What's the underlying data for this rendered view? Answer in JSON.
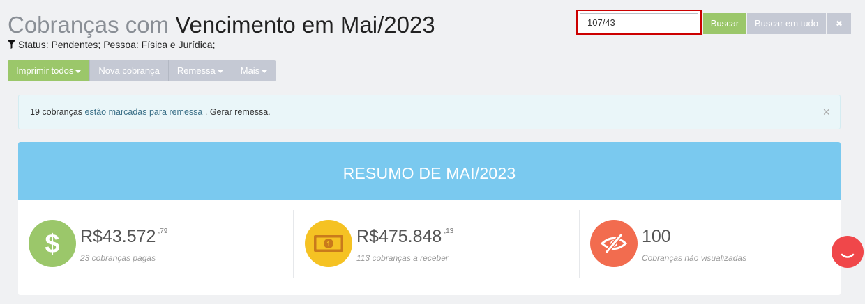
{
  "header": {
    "title_prefix": "Cobranças com",
    "title_main": "Vencimento em Mai/2023",
    "filter_text": "Status: Pendentes; Pessoa: Física e Jurídica;"
  },
  "search": {
    "value": "107/43",
    "buscar_label": "Buscar",
    "buscar_tudo_label": "Buscar em tudo",
    "clear_label": "✖"
  },
  "toolbar": {
    "imprimir_label": "Imprimir todos",
    "nova_label": "Nova cobrança",
    "remessa_label": "Remessa",
    "mais_label": "Mais"
  },
  "alert": {
    "count_text": "19 cobranças",
    "link_text": "estão marcadas para remessa",
    "after_text": ". Gerar remessa.",
    "close_label": "×"
  },
  "summary": {
    "title": "RESUMO DE MAI/2023",
    "stats": [
      {
        "icon": "dollar-icon",
        "value": "R$43.572",
        "cents": ",79",
        "subtitle": "23 cobranças pagas",
        "color": "#9bc76a"
      },
      {
        "icon": "banknote-icon",
        "value": "R$475.848",
        "cents": ",13",
        "subtitle": "113 cobranças a receber",
        "color": "#f5c223"
      },
      {
        "icon": "eye-slash-icon",
        "value": "100",
        "cents": "",
        "subtitle": "Cobranças não visualizadas",
        "color": "#f26c4f"
      }
    ]
  },
  "colors": {
    "accent_green": "#9bc76a",
    "header_blue": "#7ac9ef",
    "highlight_red": "#cc0000",
    "chat_red": "#f0474a"
  }
}
